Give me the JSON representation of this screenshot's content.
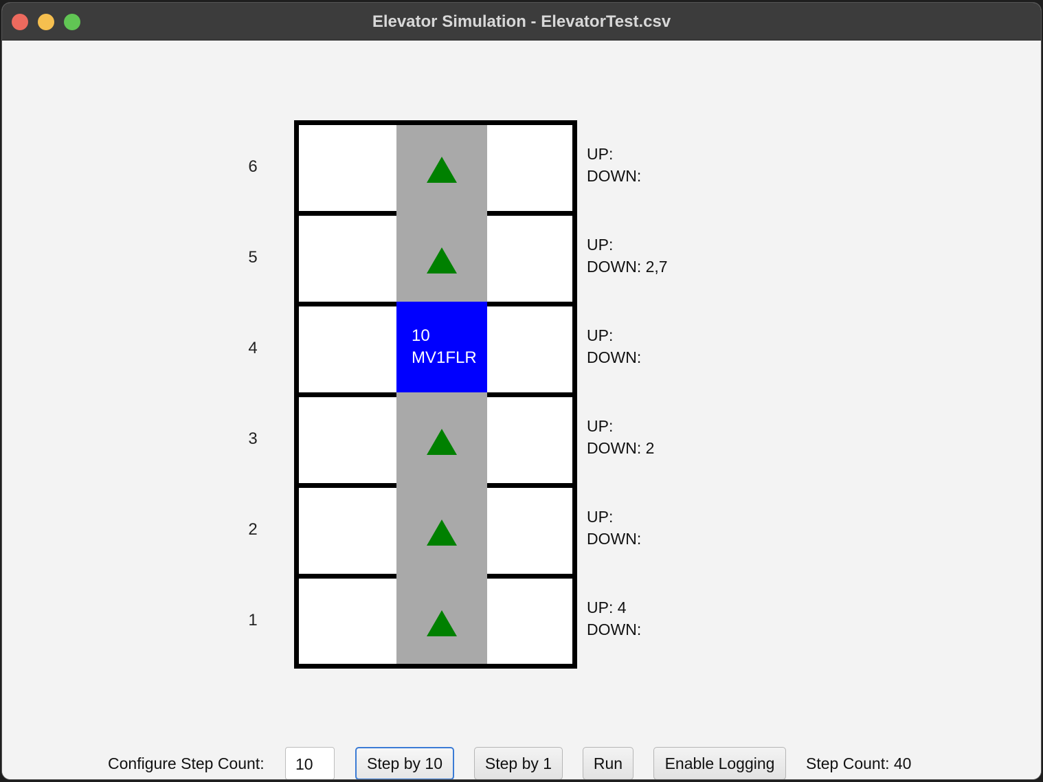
{
  "window": {
    "title": "Elevator Simulation - ElevatorTest.csv"
  },
  "floors": [
    {
      "number": "6",
      "up": "UP:",
      "down": "DOWN:",
      "marker": "up-arrow"
    },
    {
      "number": "5",
      "up": "UP:",
      "down": "DOWN: 2,7",
      "marker": "up-arrow"
    },
    {
      "number": "4",
      "up": "UP:",
      "down": "DOWN:",
      "marker": "elevator-car"
    },
    {
      "number": "3",
      "up": "UP:",
      "down": "DOWN: 2",
      "marker": "up-arrow"
    },
    {
      "number": "2",
      "up": "UP:",
      "down": "DOWN:",
      "marker": "up-arrow"
    },
    {
      "number": "1",
      "up": "UP: 4",
      "down": "DOWN:",
      "marker": "up-arrow"
    }
  ],
  "elevator": {
    "line1": "10",
    "line2": "MV1FLR",
    "color": "#0000ff"
  },
  "colors": {
    "shaft": "#a9a9a9",
    "arrow": "#008000"
  },
  "controls": {
    "step_count_label": "Configure Step Count:",
    "step_count_value": "10",
    "step_by_10": "Step by 10",
    "step_by_1": "Step by 1",
    "run": "Run",
    "enable_logging": "Enable Logging",
    "step_count_status": "Step Count: 40"
  }
}
